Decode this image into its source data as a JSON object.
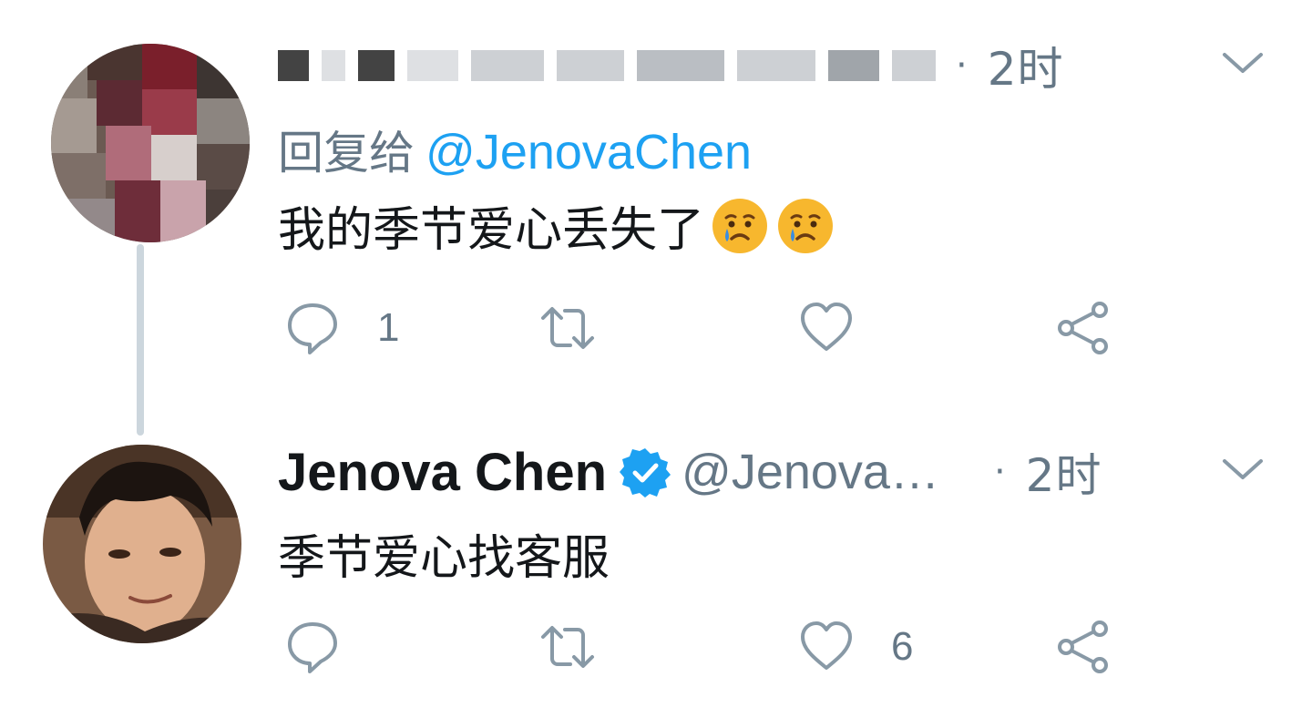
{
  "tweets": [
    {
      "author_name_redacted": true,
      "time": "2时",
      "separator": "·",
      "reply_to_label": "回复给",
      "reply_to_handle": "@JenovaChen",
      "text": "我的季节爱心丢失了",
      "emojis": [
        "crying-face",
        "crying-face"
      ],
      "actions": {
        "reply_count": "1",
        "retweet_count": "",
        "like_count": ""
      }
    },
    {
      "display_name": "Jenova Chen",
      "verified": true,
      "handle": "@Jenova…",
      "separator": "·",
      "time": "2时",
      "text": "季节爱心找客服",
      "actions": {
        "reply_count": "",
        "retweet_count": "",
        "like_count": "6"
      }
    }
  ],
  "icons": [
    "reply-icon",
    "retweet-icon",
    "like-icon",
    "share-icon",
    "caret-down-icon",
    "verified-badge-icon"
  ],
  "colors": {
    "link": "#1da1f2",
    "secondary_text": "#657786",
    "primary_text": "#14171a",
    "thread_line": "#ccd6dd"
  }
}
